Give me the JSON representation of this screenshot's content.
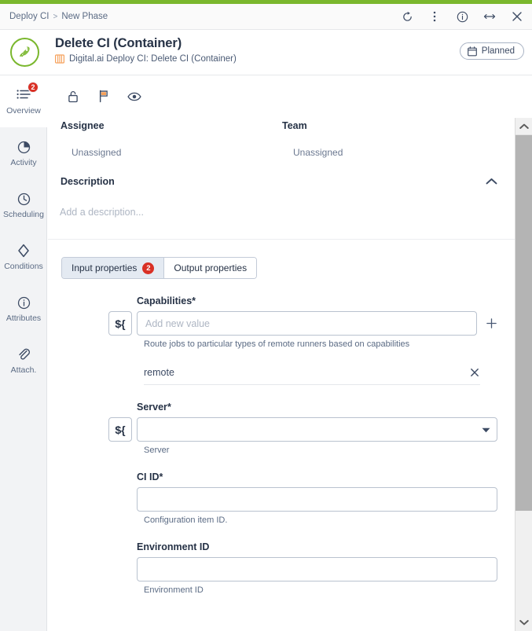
{
  "theme": {
    "accent_green": "#7ab72d",
    "badge_red": "#d93025",
    "orange": "#f5a05a",
    "text_dark": "#263246",
    "text_muted": "#5b6b84"
  },
  "chrome": {
    "breadcrumb": [
      "Deploy CI",
      "New Phase"
    ],
    "separator": ">",
    "actions": [
      {
        "name": "refresh-icon",
        "label": "Refresh"
      },
      {
        "name": "more-options-icon",
        "label": "More options"
      },
      {
        "name": "info-icon",
        "label": "Info"
      },
      {
        "name": "expand-icon",
        "label": "Expand"
      },
      {
        "name": "close-icon",
        "label": "Close"
      }
    ]
  },
  "header": {
    "logo_icon": "rocket-icon",
    "title": "Delete CI (Container)",
    "subtitle_icon": "container-icon",
    "subtitle": "Digital.ai Deploy CI: Delete CI (Container)",
    "status": {
      "label": "Planned",
      "icon": "calendar-icon"
    }
  },
  "sidebar": {
    "items": [
      {
        "label": "Overview",
        "icon": "list-icon",
        "badge": "2",
        "active": true
      },
      {
        "label": "Activity",
        "icon": "pie-chart-icon",
        "badge": null,
        "active": false
      },
      {
        "label": "Scheduling",
        "icon": "clock-icon",
        "badge": null,
        "active": false
      },
      {
        "label": "Conditions",
        "icon": "diamond-icon",
        "badge": null,
        "active": false
      },
      {
        "label": "Attributes",
        "icon": "info-circle-icon",
        "badge": null,
        "active": false
      },
      {
        "label": "Attach.",
        "icon": "paperclip-icon",
        "badge": null,
        "active": false
      }
    ]
  },
  "toolbar": {
    "icons": [
      {
        "name": "unlock-icon",
        "label": "Lock"
      },
      {
        "name": "flag-icon",
        "label": "Flag"
      },
      {
        "name": "eye-icon",
        "label": "Watch"
      }
    ]
  },
  "meta": {
    "assignee_label": "Assignee",
    "assignee_value": "Unassigned",
    "team_label": "Team",
    "team_value": "Unassigned"
  },
  "description": {
    "title": "Description",
    "collapse_icon": "chevron-up-icon",
    "placeholder": "Add a description..."
  },
  "tabs": [
    {
      "label": "Input properties",
      "badge": "2",
      "active": true
    },
    {
      "label": "Output properties",
      "badge": null,
      "active": false
    }
  ],
  "form": {
    "variable_button": "${",
    "add_icon": "plus-icon",
    "fields": [
      {
        "label": "Capabilities",
        "required": "*",
        "type": "tag-input",
        "value": "",
        "placeholder": "Add new value",
        "helper": "Route jobs to particular types of remote runners based on capabilities",
        "has_variable_button": true,
        "has_add_button": true,
        "chips": [
          {
            "text": "remote",
            "remove_icon": "close-icon"
          }
        ]
      },
      {
        "label": "Server",
        "required": "*",
        "type": "select",
        "value": "",
        "placeholder": "",
        "helper": "Server",
        "has_variable_button": true,
        "has_add_button": false,
        "caret_icon": "chevron-down-icon",
        "chips": []
      },
      {
        "label": "CI ID",
        "required": "*",
        "type": "text",
        "value": "",
        "placeholder": "",
        "helper": "Configuration item ID.",
        "has_variable_button": false,
        "has_add_button": false,
        "chips": []
      },
      {
        "label": "Environment ID",
        "required": "",
        "type": "text",
        "value": "",
        "placeholder": "",
        "helper": "Environment ID",
        "has_variable_button": false,
        "has_add_button": false,
        "chips": []
      }
    ]
  },
  "scrollbar": {
    "up_icon": "chevron-up-icon",
    "down_icon": "chevron-down-icon"
  }
}
